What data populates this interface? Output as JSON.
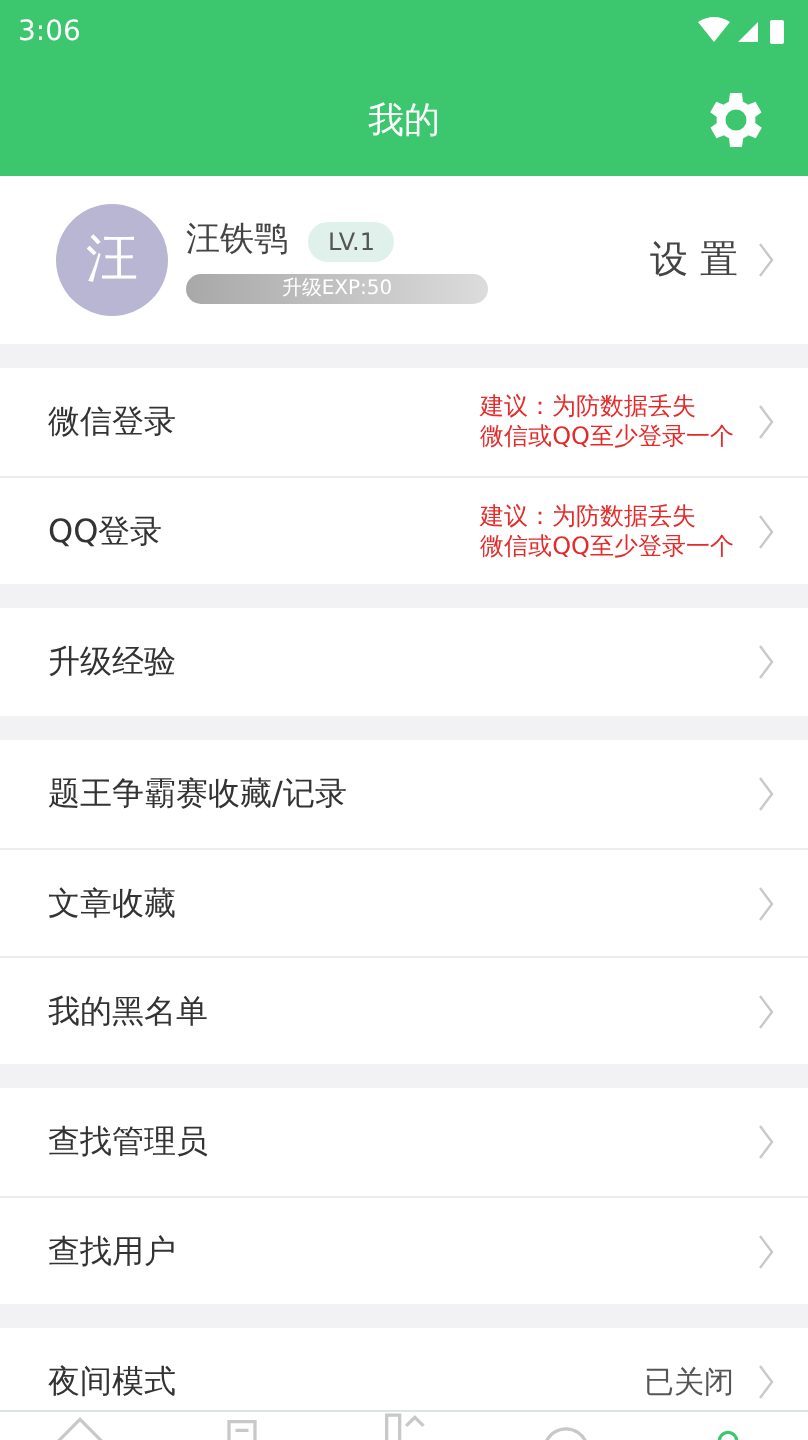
{
  "status_bar": {
    "time": "3:06"
  },
  "header": {
    "title": "我的"
  },
  "profile": {
    "avatar_letter": "汪",
    "name": "汪铁鹗",
    "level_badge": "LV.1",
    "exp_text": "升级EXP:50",
    "settings_label": "设 置"
  },
  "groups": [
    {
      "items": [
        {
          "kind": "hint",
          "label": "微信登录",
          "hint": [
            "建议：为防数据丢失",
            "微信或QQ至少登录一个"
          ]
        },
        {
          "kind": "hint",
          "label": "QQ登录",
          "hint": [
            "建议：为防数据丢失",
            "微信或QQ至少登录一个"
          ]
        }
      ]
    },
    {
      "items": [
        {
          "kind": "plain",
          "label": "升级经验"
        }
      ]
    },
    {
      "items": [
        {
          "kind": "plain",
          "label": "题王争霸赛收藏/记录"
        },
        {
          "kind": "plain",
          "label": "文章收藏"
        },
        {
          "kind": "plain",
          "label": "我的黑名单"
        }
      ]
    },
    {
      "items": [
        {
          "kind": "plain",
          "label": "查找管理员"
        },
        {
          "kind": "plain",
          "label": "查找用户"
        }
      ]
    },
    {
      "items": [
        {
          "kind": "value",
          "label": "夜间模式",
          "value": "已关闭"
        }
      ]
    }
  ],
  "bottom_nav": [
    {
      "kind": "home",
      "selected": false
    },
    {
      "kind": "document",
      "selected": false
    },
    {
      "kind": "shapes",
      "selected": false
    },
    {
      "kind": "circle",
      "selected": false
    },
    {
      "kind": "person",
      "selected": true
    }
  ]
}
